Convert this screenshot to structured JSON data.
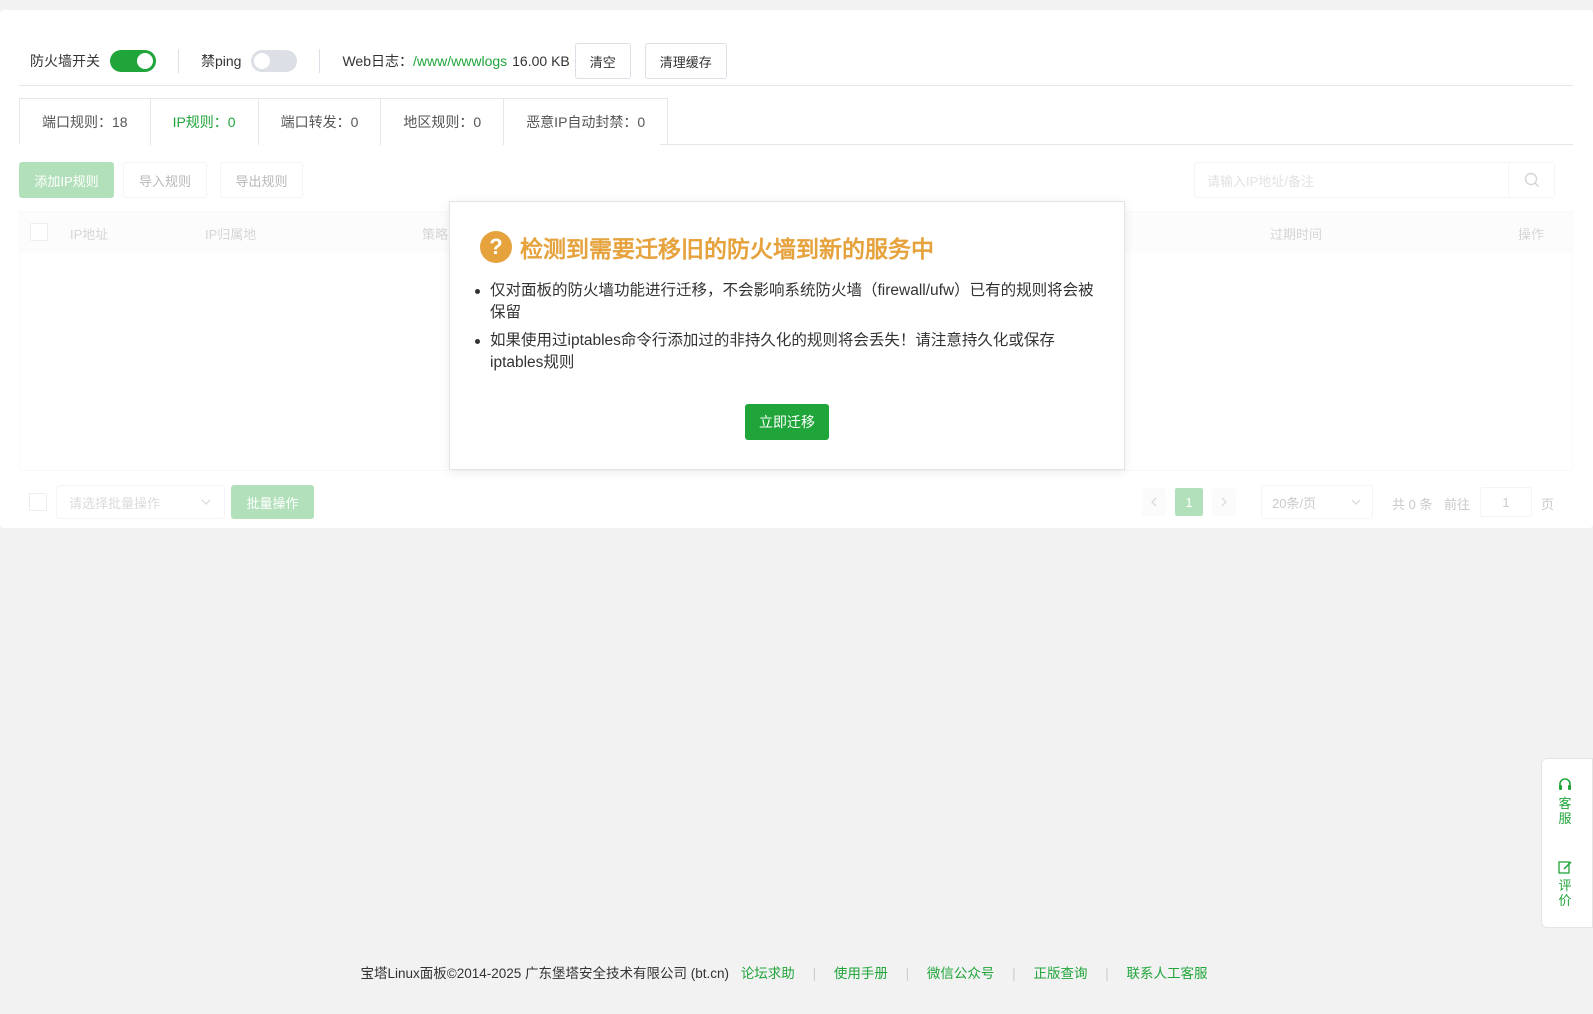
{
  "topbar": {
    "firewall_label": "防火墙开关",
    "ping_label": "禁ping",
    "weblog_label": "Web日志：",
    "weblog_path": "/www/wwwlogs",
    "weblog_size": "16.00 KB",
    "clear_label": "清空",
    "clear_cache_label": "清理缓存"
  },
  "tabs": [
    {
      "label": "端口规则：18"
    },
    {
      "label": "IP规则：0"
    },
    {
      "label": "端口转发：0"
    },
    {
      "label": "地区规则：0"
    },
    {
      "label": "恶意IP自动封禁：0"
    }
  ],
  "toolbar": {
    "add_label": "添加IP规则",
    "import_label": "导入规则",
    "export_label": "导出规则",
    "search_placeholder": "请输入IP地址/备注"
  },
  "table": {
    "columns": [
      "IP地址",
      "IP归属地",
      "策略",
      "过期时间",
      "操作"
    ]
  },
  "batch": {
    "select_placeholder": "请选择批量操作",
    "batch_label": "批量操作"
  },
  "pagination": {
    "current_page": "1",
    "page_size": "20条/页",
    "total": "共 0 条",
    "goto_label": "前往",
    "goto_value": "1",
    "page_unit": "页"
  },
  "modal": {
    "title": "检测到需要迁移旧的防火墙到新的服务中",
    "items": [
      "仅对面板的防火墙功能进行迁移，不会影响系统防火墙（firewall/ufw）已有的规则将会被保留",
      "如果使用过iptables命令行添加过的非持久化的规则将会丢失！请注意持久化或保存iptables规则"
    ],
    "button_label": "立即迁移"
  },
  "side_float": {
    "service_label": "客服",
    "review_label": "评价"
  },
  "footer": {
    "copyright": "宝塔Linux面板©2014-2025 广东堡塔安全技术有限公司 (bt.cn)",
    "links": [
      "论坛求助",
      "使用手册",
      "微信公众号",
      "正版查询",
      "联系人工客服"
    ]
  },
  "colors": {
    "brand": "#20a53a",
    "warning": "#e6a23c"
  }
}
